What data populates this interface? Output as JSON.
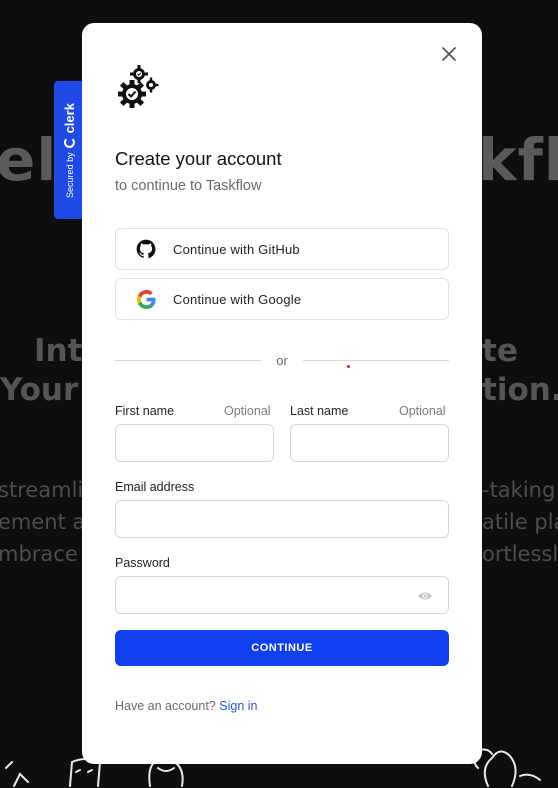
{
  "background": {
    "heading_left": "elc",
    "heading_right": "kflo",
    "line2_left": "Int",
    "line2_right": "te",
    "line3_left": "Your",
    "line3_right": "tion.",
    "para1_left": "streamli",
    "para1_right": "-taking",
    "para2_left": "ement a",
    "para2_right": "atile pla",
    "para3_left": "mbrace f",
    "para3_right": "ortlessly"
  },
  "badge": {
    "secured_by": "Secured by",
    "brand": "clerk"
  },
  "modal": {
    "title": "Create your account",
    "subtitle": "to continue to Taskflow",
    "github_label": "Continue with GitHub",
    "google_label": "Continue with Google",
    "divider_text": "or",
    "first_name_label": "First name",
    "first_name_optional": "Optional",
    "last_name_label": "Last name",
    "last_name_optional": "Optional",
    "email_label": "Email address",
    "password_label": "Password",
    "continue_label": "CONTINUE",
    "footer_text": "Have an account?",
    "sign_in_label": "Sign in"
  },
  "colors": {
    "primary": "#103ff0",
    "badge": "#1f4ae6",
    "link": "#2554d8",
    "backdrop": "#0f0f0f"
  },
  "icons": {
    "close": "close-icon",
    "logo": "gears-logo-icon",
    "github": "github-icon",
    "google": "google-icon",
    "password_toggle": "eye-icon"
  }
}
